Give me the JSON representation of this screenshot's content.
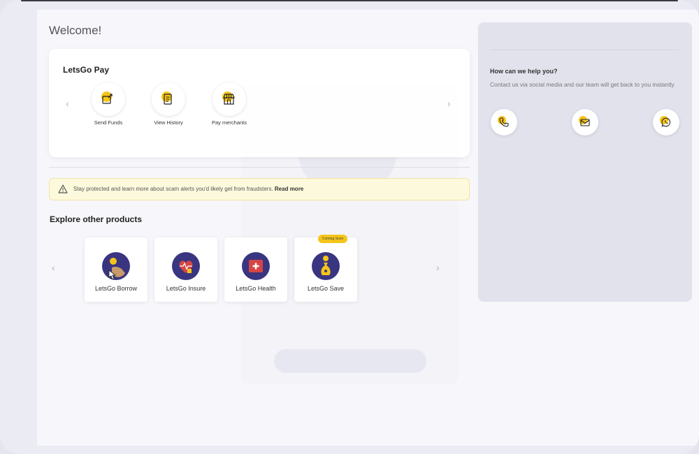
{
  "page": {
    "welcome": "Welcome!"
  },
  "pay": {
    "title": "LetsGo Pay",
    "items": [
      {
        "label": "Send Funds",
        "icon": "send-funds-icon"
      },
      {
        "label": "View History",
        "icon": "history-icon"
      },
      {
        "label": "Pay merchants",
        "icon": "merchant-icon"
      }
    ]
  },
  "alert": {
    "text": "Stay protected and learn more about scam alerts you'd likely get from fraudsters.",
    "link": "Read more"
  },
  "explore": {
    "title": "Explore other products",
    "products": [
      {
        "label": "LetsGo Borrow"
      },
      {
        "label": "LetsGo Insure"
      },
      {
        "label": "LetsGo Health"
      },
      {
        "label": "LetsGo Save",
        "badge": "Coming Soon"
      }
    ]
  },
  "help": {
    "title": "How can we help you?",
    "subtitle": "Contact us via social media and our team will get back to you instantly",
    "contacts": [
      "phone-icon",
      "email-icon",
      "whatsapp-icon"
    ]
  },
  "colors": {
    "accent": "#f5c518",
    "brand": "#3a3580"
  }
}
